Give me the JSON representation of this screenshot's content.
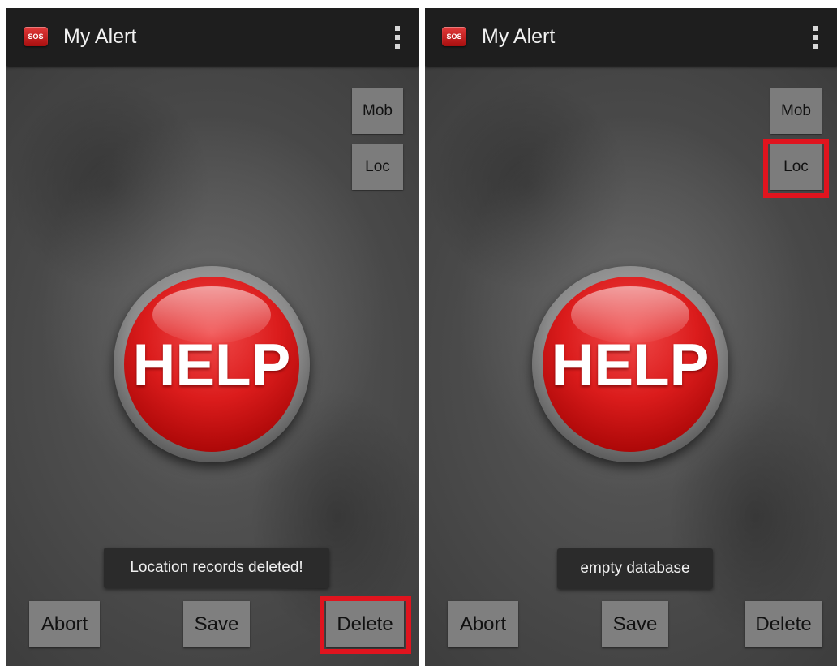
{
  "screens": [
    {
      "app_icon_text": "SOS",
      "title": "My Alert",
      "side_buttons": {
        "mob": "Mob",
        "loc": "Loc"
      },
      "help_label": "HELP",
      "toast": "Location records deleted!",
      "bottom_buttons": {
        "abort": "Abort",
        "save": "Save",
        "delete": "Delete"
      },
      "highlighted_control": "Delete"
    },
    {
      "app_icon_text": "SOS",
      "title": "My Alert",
      "side_buttons": {
        "mob": "Mob",
        "loc": "Loc"
      },
      "help_label": "HELP",
      "toast": "empty database",
      "bottom_buttons": {
        "abort": "Abort",
        "save": "Save",
        "delete": "Delete"
      },
      "highlighted_control": "Loc"
    }
  ],
  "colors": {
    "highlight": "#e0141e",
    "help_red": "#db1c1c",
    "action_bar": "#1e1e1e",
    "button_gray": "#7f7f7f"
  },
  "icons": [
    "app-sos-icon",
    "overflow-menu-icon"
  ]
}
